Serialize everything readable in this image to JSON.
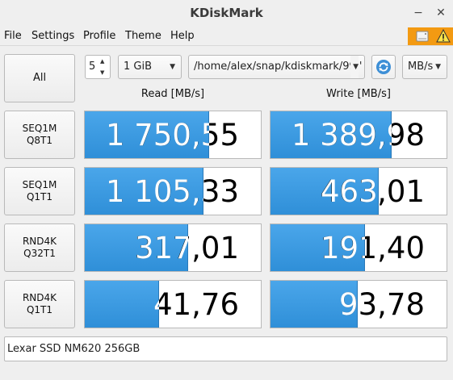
{
  "window": {
    "title": "KDiskMark"
  },
  "menu": [
    "File",
    "Settings",
    "Profile",
    "Theme",
    "Help"
  ],
  "status_icons": [
    "drive-icon",
    "warning-icon"
  ],
  "controls": {
    "all_label": "All",
    "loops": "5",
    "size": "1 GiB",
    "path": "/home/alex/snap/kdiskmark/99 '",
    "units": "MB/s"
  },
  "headers": {
    "read": "Read [MB/s]",
    "write": "Write [MB/s]"
  },
  "tests": [
    {
      "line1": "SEQ1M",
      "line2": "Q8T1",
      "read": "1 750,55",
      "read_fill": 0.7,
      "write": "1 389,98",
      "write_fill": 0.68
    },
    {
      "line1": "SEQ1M",
      "line2": "Q1T1",
      "read": "1 105,33",
      "read_fill": 0.67,
      "write": "463,01",
      "write_fill": 0.61
    },
    {
      "line1": "RND4K",
      "line2": "Q32T1",
      "read": "317,01",
      "read_fill": 0.58,
      "write": "191,40",
      "write_fill": 0.53
    },
    {
      "line1": "RND4K",
      "line2": "Q1T1",
      "read": "41,76",
      "read_fill": 0.42,
      "write": "93,78",
      "write_fill": 0.49
    }
  ],
  "device": "Lexar SSD NM620 256GB"
}
